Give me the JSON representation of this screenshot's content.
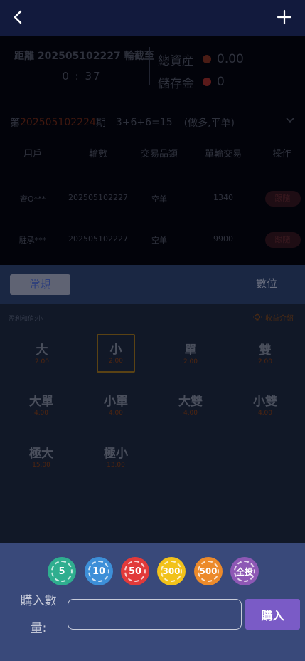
{
  "header": {
    "back_icon": "chevron-left-icon",
    "add_icon": "plus-icon"
  },
  "countdown": {
    "label": "距離 202505102227 輪截至",
    "time": "0 : 37"
  },
  "assets": {
    "total_label": "總資産",
    "total_value": "0.00",
    "deposit_label": "儲存金",
    "deposit_value": "0"
  },
  "period": {
    "prefix": "第",
    "number": "202505102224",
    "suffix": "期",
    "result": "3+6+6=15",
    "tag": "(做多,平单)"
  },
  "table": {
    "headers": [
      "用戶",
      "輪數",
      "交易品類",
      "單輪交易",
      "操作"
    ],
    "rows": [
      {
        "user": "齊O***",
        "round": "202505102227",
        "type": "空单",
        "amount": "1340",
        "action": "跟隨"
      },
      {
        "user": "駐承***",
        "round": "202505102227",
        "type": "空单",
        "amount": "9900",
        "action": "跟隨"
      }
    ]
  },
  "tabs": {
    "regular": "常規",
    "digit": "數位"
  },
  "panel": {
    "hint": "盈利和值:小",
    "intro": "收益介紹",
    "options": [
      {
        "label": "大",
        "odds": "2.00"
      },
      {
        "label": "小",
        "odds": "2.00"
      },
      {
        "label": "單",
        "odds": "2.00"
      },
      {
        "label": "雙",
        "odds": "2.00"
      },
      {
        "label": "大單",
        "odds": "4.00"
      },
      {
        "label": "小單",
        "odds": "4.00"
      },
      {
        "label": "大雙",
        "odds": "4.00"
      },
      {
        "label": "小雙",
        "odds": "4.00"
      },
      {
        "label": "極大",
        "odds": "15.00"
      },
      {
        "label": "極小",
        "odds": "13.00"
      }
    ]
  },
  "chips": [
    {
      "label": "5",
      "color": "#2fae8f"
    },
    {
      "label": "10",
      "color": "#3d8fd8"
    },
    {
      "label": "50",
      "color": "#e23a3a"
    },
    {
      "label": "300",
      "color": "#f2c21a"
    },
    {
      "label": "500",
      "color": "#ec8a2a"
    },
    {
      "label": "全投",
      "color": "#8e58b5"
    }
  ],
  "purchase": {
    "qty_label": "購入數量:",
    "input_value": "",
    "buy_label": "購入",
    "buy_color": "#7a5bc6"
  }
}
